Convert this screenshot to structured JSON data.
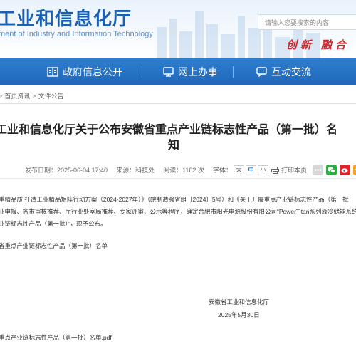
{
  "header": {
    "title": "工业和信息化厅",
    "subtitle": "ment of Industry and Information Technology",
    "search_placeholder": "请输入您要搜索的内容",
    "slogan": "创新 融合 求"
  },
  "nav": {
    "items": [
      {
        "label": "政府信息公开",
        "icon": "book-icon"
      },
      {
        "label": "网上办事",
        "icon": "monitor-icon"
      },
      {
        "label": "互动交流",
        "icon": "chat-icon"
      }
    ]
  },
  "breadcrumb": {
    "home": "首页资讯",
    "current": "文件公告",
    "separator": ">"
  },
  "article": {
    "title_line1": "工业和信息化厅关于公布安徽省重点产业链标志性产品（第一批）名",
    "title_line2": "知",
    "meta": {
      "date": "发布日期：2025-06-04 17:40",
      "source": "来源：科技处",
      "views": "阅读：1162 次",
      "size_label": "字体：",
      "size_large": "大",
      "size_medium": "中",
      "size_small": "小",
      "print": "打印本页"
    },
    "paragraphs": [
      "重精品质 打造工业精品矩阵行动方案（2024-2027年）》（皖制造强省组〔2024〕5号）和《关于开展重点产业链标志性产品（第一批",
      "业申报、各市审核推荐、厅行业处室局推荐、专家评审、公示等程序，确定合肥市阳光电源股份有限公司“PowerTitan系列液冷储能系统",
      "业链标志性产品（第一批）”，现予公布。",
      "省重点产业链标志性产品（第一批）名单"
    ],
    "signature_org": "安徽省工业和信息化厅",
    "signature_date": "2025年5月30日",
    "attachment": "重点产业链标志性产品（第一批）名单.pdf"
  },
  "colors": {
    "brand_blue": "#1f67b8",
    "nav_top": "#2f7ed0",
    "slogan_red": "#c9272d"
  }
}
